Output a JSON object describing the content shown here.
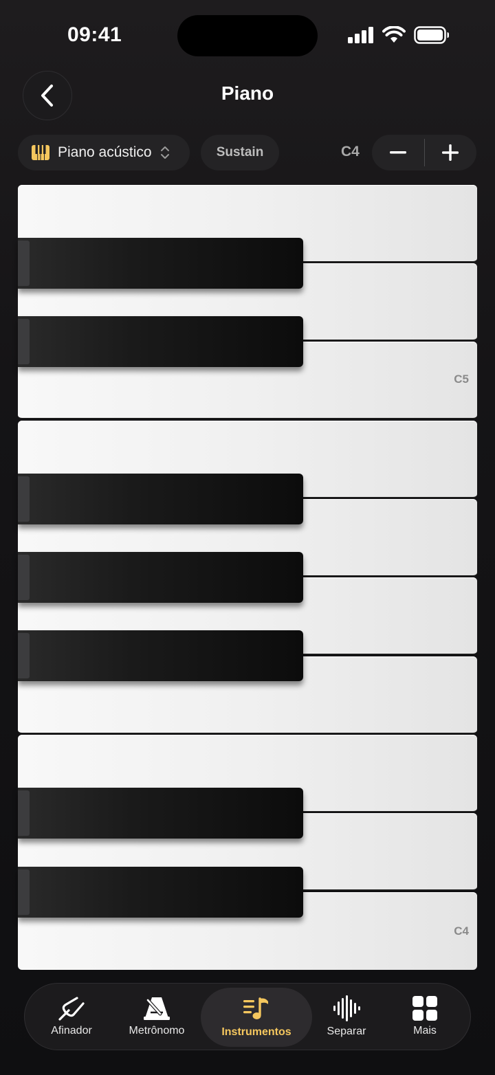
{
  "status_bar": {
    "time": "09:41"
  },
  "header": {
    "title": "Piano"
  },
  "controls": {
    "instrument": "Piano acústico",
    "sustain": "Sustain",
    "octave": "C4",
    "minus": "−",
    "plus": "+"
  },
  "keyboard": {
    "white_key_labels": {
      "c5": "C5",
      "c4": "C4"
    }
  },
  "tabbar": {
    "items": [
      {
        "label": "Afinador",
        "icon": "tuning-fork-icon"
      },
      {
        "label": "Metrônomo",
        "icon": "metronome-icon"
      },
      {
        "label": "Instrumentos",
        "icon": "music-note-list-icon",
        "active": true
      },
      {
        "label": "Separar",
        "icon": "waveform-icon"
      },
      {
        "label": "Mais",
        "icon": "grid-icon"
      }
    ]
  },
  "colors": {
    "accent": "#f5c75e",
    "background": "#121113"
  }
}
